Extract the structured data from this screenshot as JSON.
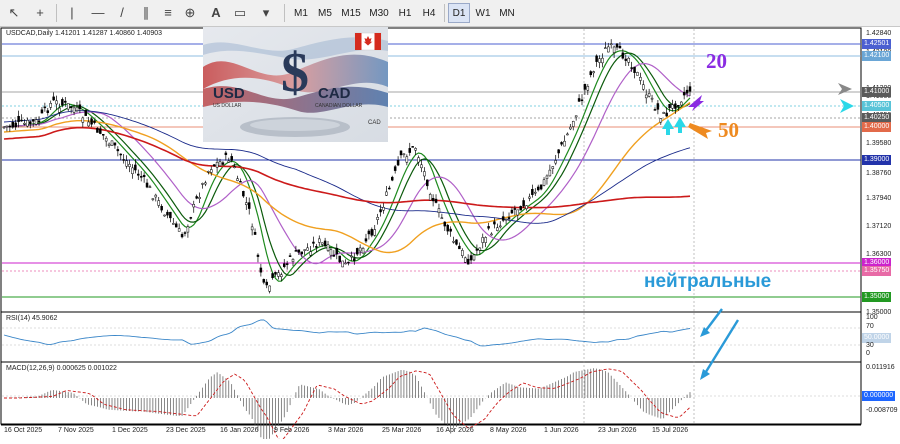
{
  "toolbar": {
    "timeframes": [
      "M1",
      "M5",
      "M15",
      "M30",
      "H1",
      "H4",
      "D1",
      "W1",
      "MN"
    ],
    "active_timeframe": "D1"
  },
  "chart": {
    "title": "USDCAD,Daily  1.41201 1.41287 1.40860 1.40903",
    "price_axis": [
      "1.42840",
      "1.42501",
      "1.42100",
      "1.41200",
      "1.41000",
      "1.40500",
      "1.40250",
      "1.40000",
      "1.39580",
      "1.39000",
      "1.38760",
      "1.37940",
      "1.37120",
      "1.36300",
      "1.36000",
      "1.35750",
      "1.35500",
      "1.35000",
      "1.34680"
    ],
    "level_tags": [
      {
        "text": "1.42501",
        "color": "#4b5fd1"
      },
      {
        "text": "1.42100",
        "color": "#6aa6d6"
      },
      {
        "text": "1.41000",
        "color": "#5a5a5a"
      },
      {
        "text": "1.40500",
        "color": "#59c4d8"
      },
      {
        "text": "1.40250",
        "color": "#5a5a5a"
      },
      {
        "text": "1.40000",
        "color": "#e26a4a"
      },
      {
        "text": "1.39000",
        "color": "#2233aa"
      },
      {
        "text": "1.36000",
        "color": "#cc22cc"
      },
      {
        "text": "1.35750",
        "color": "#e86aa6"
      },
      {
        "text": "1.35000",
        "color": "#229922"
      }
    ],
    "date_axis": [
      "16 Oct 2025",
      "7 Nov 2025",
      "1 Dec 2025",
      "23 Dec 2025",
      "16 Jan 2026",
      "9 Feb 2026",
      "3 Mar 2026",
      "25 Mar 2026",
      "16 Apr 2026",
      "8 May 2026",
      "1 Jun 2026",
      "23 Jun 2026",
      "15 Jul 2026"
    ],
    "annotation_20": "20",
    "annotation_50": "50",
    "annotation_neutral": "нейтральные"
  },
  "logo": {
    "left": "USD",
    "left_sub": "US DOLLAR",
    "right": "CAD",
    "right_sub": "CANADIAN DOLLAR",
    "corner": "CAD"
  },
  "rsi": {
    "title": "RSI(14) 45.9062",
    "axis": [
      "100",
      "70",
      "50.0000",
      "30",
      "0"
    ]
  },
  "macd": {
    "title": "MACD(12,26,9) 0.000625 0.001022",
    "axis": [
      "0.011916",
      "0.000000",
      "-0.008709"
    ]
  },
  "colors": {
    "candle": "#000000",
    "ma_green_fast": "#1e8a1e",
    "ma_green": "#0b5a0b",
    "ma_purple": "#b060c8",
    "ma_orange": "#f0a020",
    "ma_blue": "#1a2a8a",
    "ma_red": "#cc1a1a",
    "rsi": "#3a86c8",
    "annotation": "#2a9ad8"
  }
}
